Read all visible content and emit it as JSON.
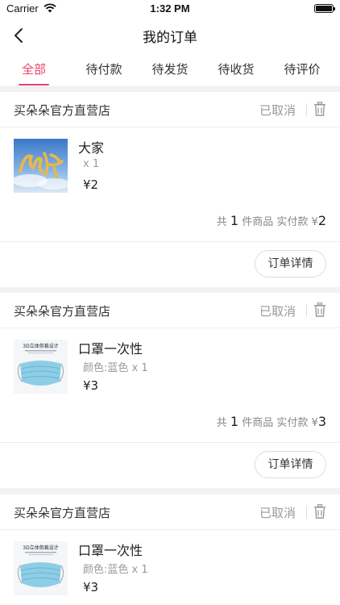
{
  "status_bar": {
    "carrier": "Carrier",
    "time": "1:32 PM"
  },
  "nav": {
    "title": "我的订单"
  },
  "tabs": [
    {
      "label": "全部",
      "active": true
    },
    {
      "label": "待付款",
      "active": false
    },
    {
      "label": "待发货",
      "active": false
    },
    {
      "label": "待收货",
      "active": false
    },
    {
      "label": "待评价",
      "active": false
    }
  ],
  "colors": {
    "accent": "#e8436e",
    "muted": "#999999"
  },
  "orders": [
    {
      "shop": "买朵朵官方直营店",
      "status": "已取消",
      "product": {
        "name": "大家",
        "spec": "x 1",
        "price": "¥2",
        "thumb": "calligraphy-image"
      },
      "summary": {
        "prefix": "共",
        "count": "1",
        "middle": "件商品 实付款",
        "currency": "¥",
        "total": "2"
      },
      "detail_label": "订单详情"
    },
    {
      "shop": "买朵朵官方直营店",
      "status": "已取消",
      "product": {
        "name": "口罩一次性",
        "spec": "颜色:蓝色 x 1",
        "price": "¥3",
        "thumb": "mask-image",
        "thumb_caption": "3D立体剪裁设计"
      },
      "summary": {
        "prefix": "共",
        "count": "1",
        "middle": "件商品 实付款",
        "currency": "¥",
        "total": "3"
      },
      "detail_label": "订单详情"
    },
    {
      "shop": "买朵朵官方直营店",
      "status": "已取消",
      "product": {
        "name": "口罩一次性",
        "spec": "颜色:蓝色 x 1",
        "price": "¥3",
        "thumb": "mask-image",
        "thumb_caption": "3D立体剪裁设计"
      }
    }
  ]
}
